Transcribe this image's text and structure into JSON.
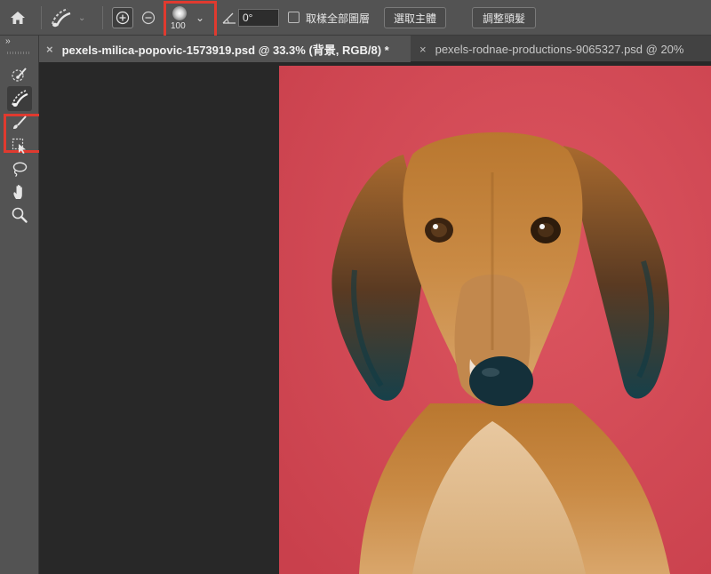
{
  "options_bar": {
    "home_icon": "home-icon",
    "tool_preset_icon": "quick-selection-brush-icon",
    "add_to_selection_icon": "add-to-selection-icon",
    "subtract_from_selection_icon": "subtract-from-selection-icon",
    "brush_size": "100",
    "angle_icon": "angle-icon",
    "angle_value": "0°",
    "sample_all_layers_label": "取樣全部圖層",
    "sample_all_layers_checked": false,
    "select_subject_label": "選取主體",
    "refine_hair_label": "調整頭髮"
  },
  "toolbar": {
    "collapse_label": "››",
    "tools": [
      {
        "name": "quick-selection-tool",
        "icon": "quick-selection-icon"
      },
      {
        "name": "object-selection-brush-tool",
        "icon": "selection-brush-icon",
        "active": true
      },
      {
        "name": "brush-tool",
        "icon": "brush-icon"
      },
      {
        "name": "object-selection-tool",
        "icon": "object-selection-icon"
      },
      {
        "name": "lasso-tool",
        "icon": "lasso-icon"
      },
      {
        "name": "hand-tool",
        "icon": "hand-icon"
      },
      {
        "name": "zoom-tool",
        "icon": "zoom-icon"
      }
    ]
  },
  "tabs": [
    {
      "close": "×",
      "label": "pexels-milica-popovic-1573919.psd @ 33.3% (背景, RGB/8) *",
      "active": true
    },
    {
      "close": "×",
      "label": "pexels-rodnae-productions-9065327.psd @ 20%",
      "active": false
    }
  ],
  "colors": {
    "highlight": "#e03a2f",
    "panel": "#535353",
    "canvas_bg": "#282828",
    "photo_background": "#d44a55"
  }
}
